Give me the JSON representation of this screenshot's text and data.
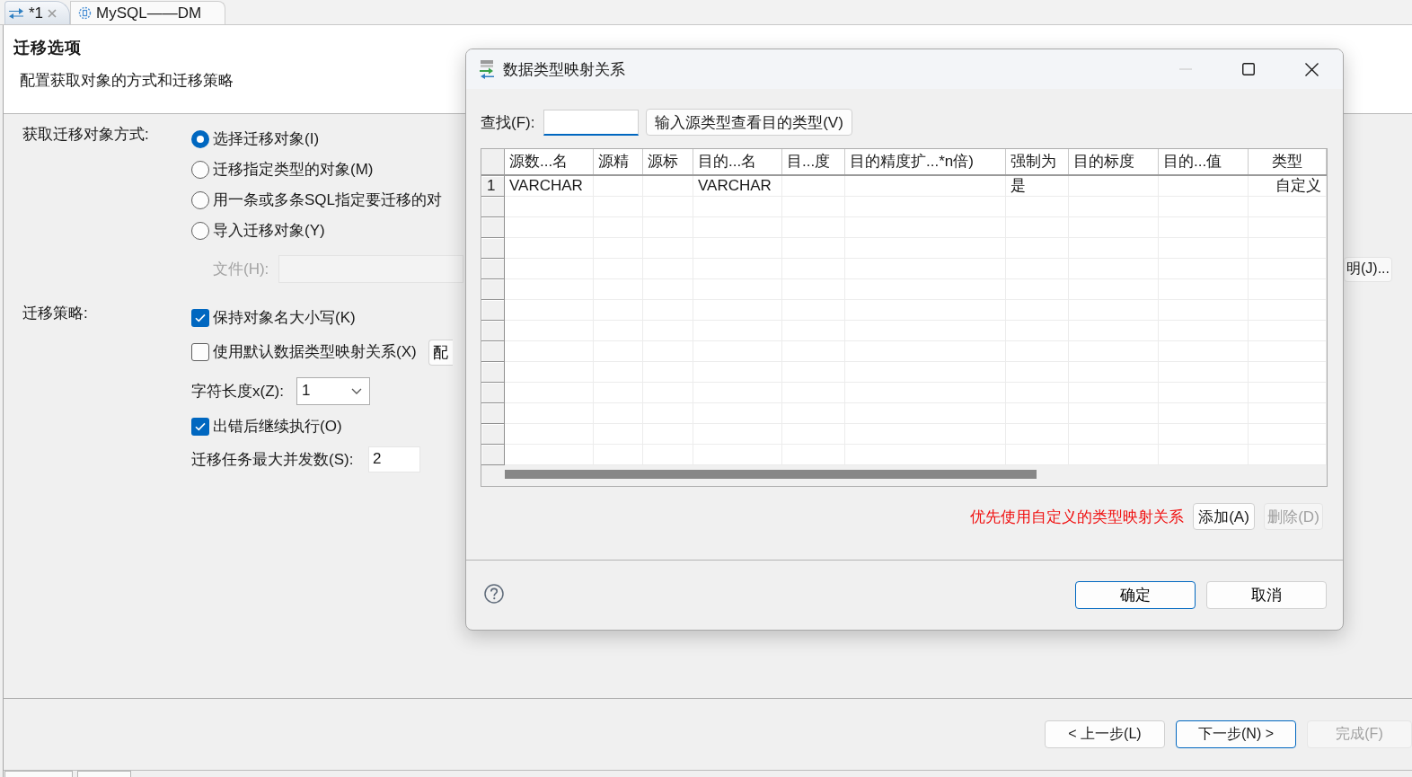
{
  "editor_tabs": [
    {
      "label": "*1",
      "selected": true,
      "closable": true
    },
    {
      "label": "MySQL——DM",
      "selected": false,
      "closable": false
    }
  ],
  "page": {
    "title": "迁移选项",
    "subtitle": "配置获取对象的方式和迁移策略"
  },
  "fetch_mode": {
    "label": "获取迁移对象方式:",
    "options": [
      {
        "label": "选择迁移对象(I)",
        "selected": true
      },
      {
        "label": "迁移指定类型的对象(M)",
        "selected": false
      },
      {
        "label": "用一条或多条SQL指定要迁移的对",
        "selected": false
      },
      {
        "label": "导入迁移对象(Y)",
        "selected": false
      }
    ],
    "file": {
      "label": "文件(H):",
      "disabled": true,
      "button": "明(J)..."
    }
  },
  "strategy": {
    "label": "迁移策略:",
    "items": [
      {
        "kind": "checkbox",
        "label": "保持对象名大小写(K)",
        "checked": true
      },
      {
        "kind": "checkbox",
        "label": "使用默认数据类型映射关系(X)",
        "checked": false,
        "button": "配"
      },
      {
        "kind": "select",
        "label": "字符长度x(Z):",
        "value": "1"
      },
      {
        "kind": "checkbox",
        "label": "出错后继续执行(O)",
        "checked": true
      },
      {
        "kind": "input",
        "label": "迁移任务最大并发数(S):",
        "value": "2"
      }
    ]
  },
  "wizard_buttons": [
    {
      "label": "< 上一步(L)",
      "focused": false,
      "disabled": false
    },
    {
      "label": "下一步(N) >",
      "focused": true,
      "disabled": false
    },
    {
      "label": "完成(F)",
      "focused": false,
      "disabled": true
    }
  ],
  "dialog": {
    "title": "数据类型映射关系",
    "search": {
      "label": "查找(F):",
      "focused": true
    },
    "lookup_button": "输入源类型查看目的类型(V)",
    "table": {
      "columns": [
        "源数...名",
        "源精",
        "源标",
        "目的...名",
        "目...度",
        "目的精度扩...*n倍)",
        "强制为",
        "目的标度",
        "目的...值",
        "类型"
      ],
      "rows": [
        {
          "number": "1",
          "cells": [
            "VARCHAR",
            null,
            null,
            "VARCHAR",
            null,
            null,
            "是",
            null,
            null,
            "自定义"
          ]
        }
      ]
    },
    "hint": "优先使用自定义的类型映射关系",
    "actions": [
      {
        "label": "添加(A)",
        "disabled": false
      },
      {
        "label": "删除(D)",
        "disabled": true
      }
    ],
    "buttons": [
      {
        "label": "确定",
        "default": true
      },
      {
        "label": "取消",
        "default": false
      }
    ]
  }
}
